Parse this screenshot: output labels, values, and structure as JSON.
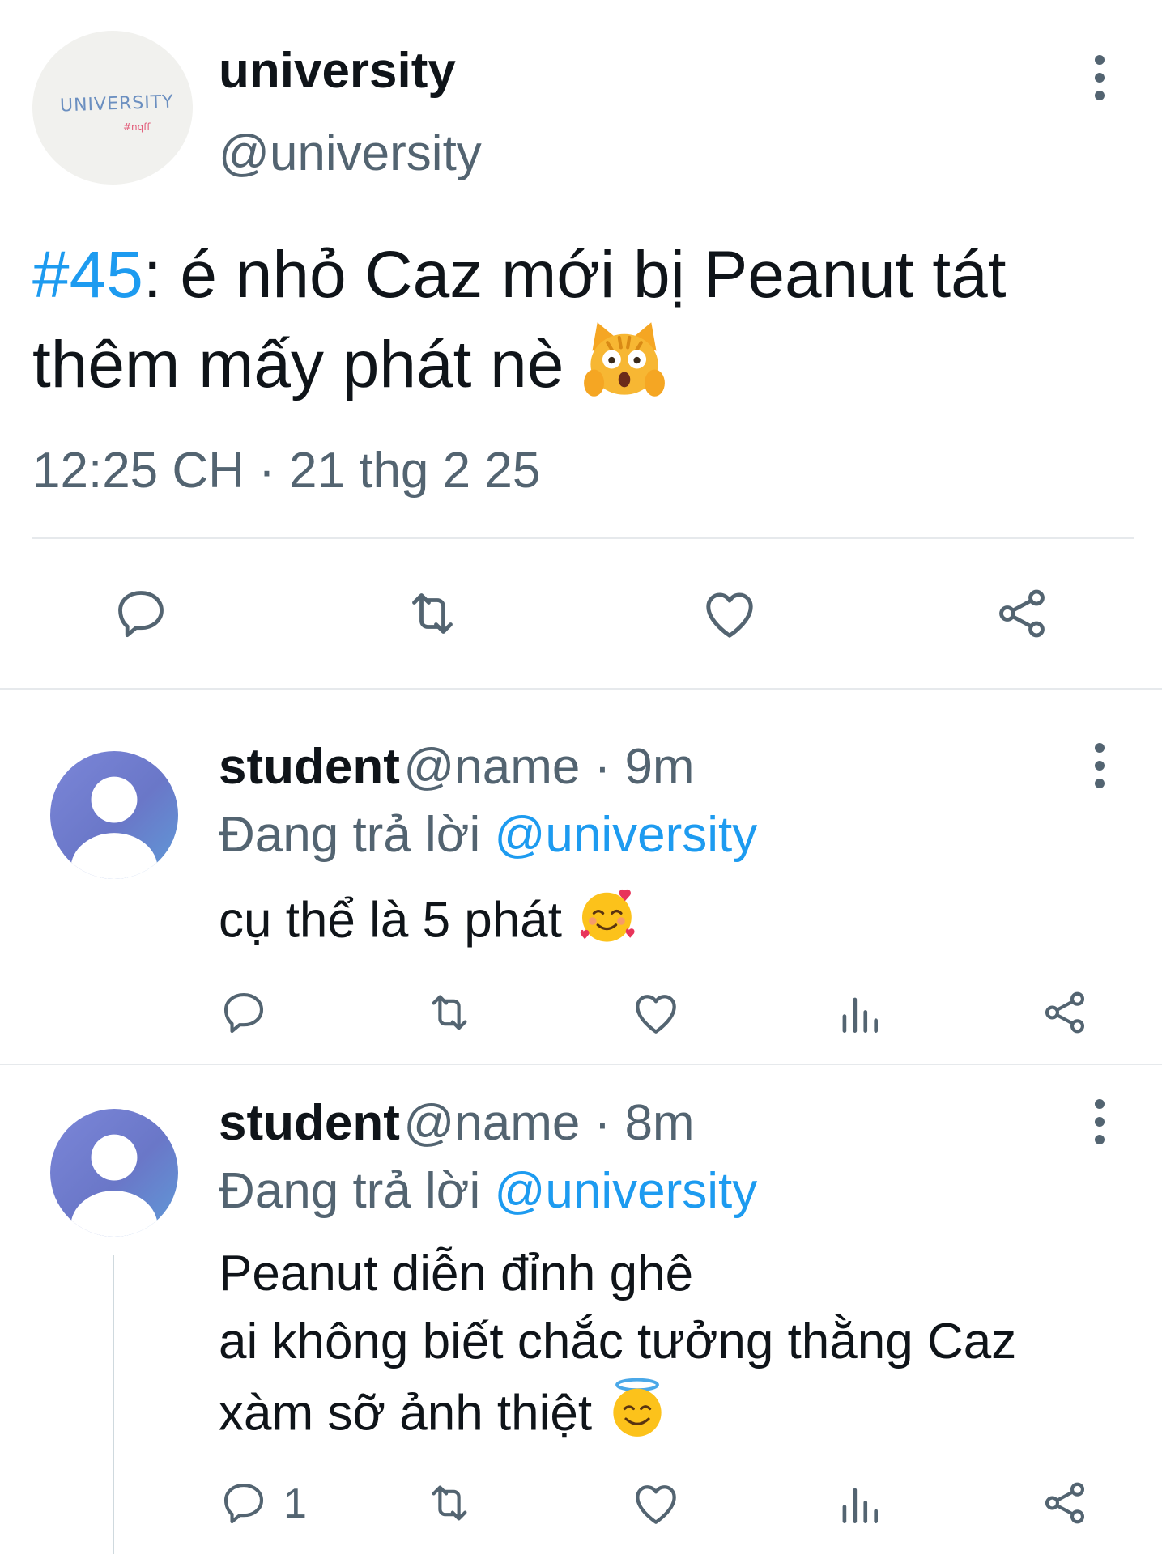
{
  "main_tweet": {
    "avatar_logo_text": "UNIVERSITY",
    "avatar_logo_sub": "#nqff",
    "display_name": "university",
    "handle": "@university",
    "hashtag": "#45",
    "text": ": é nhỏ Caz mới bị Peanut tát thêm mấy phát nè",
    "emoji": "😱",
    "timestamp": "12:25 CH · 21 thg 2 25",
    "actions": [
      "reply-icon",
      "retweet-icon",
      "like-icon",
      "share-icon"
    ]
  },
  "replies": [
    {
      "display_name": "student",
      "handle_time": "@name · 9m",
      "replying_prefix": "Đang trả lời",
      "replying_to": "@university",
      "text": "cụ thể là 5 phát",
      "emoji": "🥰",
      "reply_count": ""
    },
    {
      "display_name": "student",
      "handle_time": "@name · 8m",
      "replying_prefix": "Đang trả lời",
      "replying_to": "@university",
      "lines": [
        "Peanut diễn đỉnh ghê",
        "ai không biết chắc tưởng thằng Caz",
        "xàm sỡ ảnh thiệt"
      ],
      "emoji": "😇",
      "reply_count": "1"
    }
  ],
  "colors": {
    "accent": "#1d9bf0",
    "secondary_text": "#536471",
    "divider": "#e6e9ec"
  }
}
